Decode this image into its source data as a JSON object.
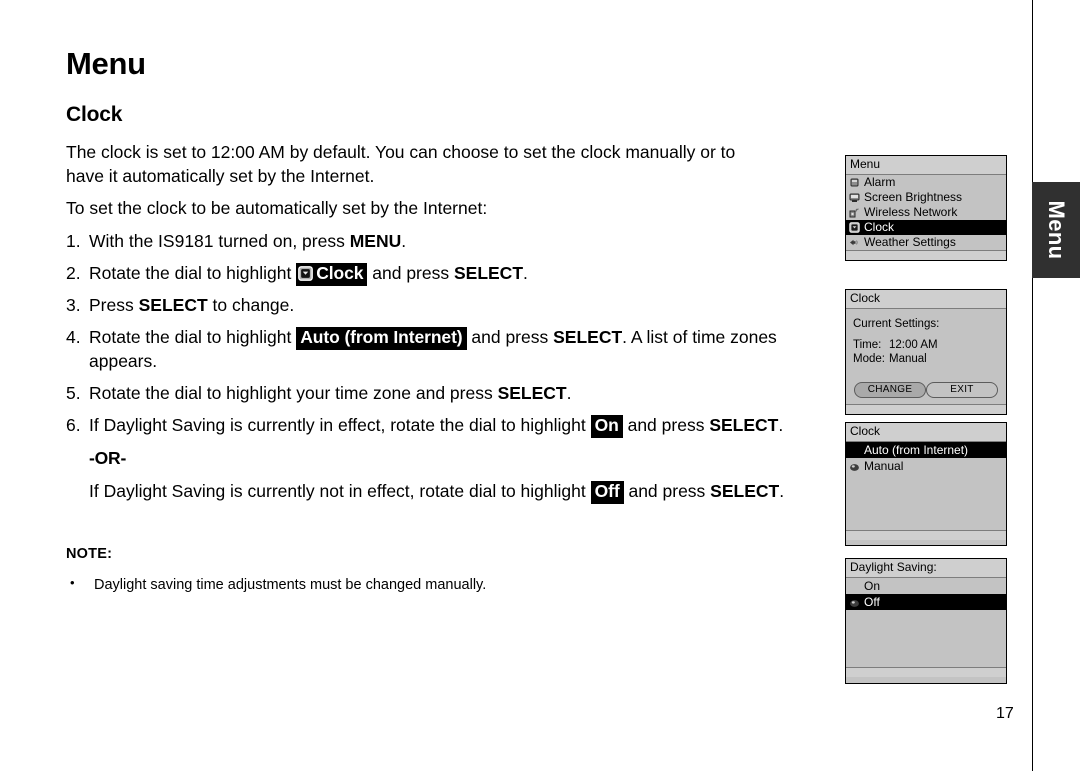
{
  "page": {
    "title": "Menu",
    "section_title": "Clock",
    "number": "17",
    "side_tab_label": "Menu"
  },
  "intro": {
    "paragraph_1_a": "The clock is set to 12:00 AM by default. You can choose to set the clock manually or to have it automatically set by the Internet.",
    "paragraph_2": "To set the clock to be automatically set by the Internet:"
  },
  "steps": [
    {
      "num": "1.",
      "parts": [
        {
          "t": "With the IS9181 turned on, press ",
          "s": "plain"
        },
        {
          "t": "MENU",
          "s": "bold"
        },
        {
          "t": ".",
          "s": "plain"
        }
      ]
    },
    {
      "num": "2.",
      "parts": [
        {
          "t": "Rotate the dial to highlight ",
          "s": "plain"
        },
        {
          "t": "Clock",
          "s": "badge-icon"
        },
        {
          "t": " and press ",
          "s": "plain"
        },
        {
          "t": "SELECT",
          "s": "bold"
        },
        {
          "t": ".",
          "s": "plain"
        }
      ]
    },
    {
      "num": "3.",
      "parts": [
        {
          "t": "Press ",
          "s": "plain"
        },
        {
          "t": "SELECT",
          "s": "bold"
        },
        {
          "t": " to change.",
          "s": "plain"
        }
      ]
    },
    {
      "num": "4.",
      "parts": [
        {
          "t": "Rotate the dial to highlight ",
          "s": "plain"
        },
        {
          "t": "Auto (from Internet)",
          "s": "badge"
        },
        {
          "t": " and press ",
          "s": "plain"
        },
        {
          "t": "SELECT",
          "s": "bold"
        },
        {
          "t": ". A list of time zones appears.",
          "s": "plain"
        }
      ]
    },
    {
      "num": "5.",
      "parts": [
        {
          "t": "Rotate the dial to highlight your time zone and press ",
          "s": "plain"
        },
        {
          "t": "SELECT",
          "s": "bold"
        },
        {
          "t": ".",
          "s": "plain"
        }
      ]
    },
    {
      "num": "6.",
      "parts": [
        {
          "t": "If Daylight Saving is currently in effect, rotate the dial to highlight ",
          "s": "plain"
        },
        {
          "t": "On",
          "s": "badge"
        },
        {
          "t": " and press ",
          "s": "plain"
        },
        {
          "t": "SELECT",
          "s": "bold"
        },
        {
          "t": ".",
          "s": "plain"
        }
      ]
    }
  ],
  "or_label": "-OR-",
  "alternate": {
    "parts": [
      {
        "t": "If Daylight Saving is currently not in effect, rotate dial to highlight ",
        "s": "plain"
      },
      {
        "t": "Off",
        "s": "badge"
      },
      {
        "t": " and press ",
        "s": "plain"
      },
      {
        "t": "SELECT",
        "s": "bold"
      },
      {
        "t": ".",
        "s": "plain"
      }
    ]
  },
  "note": {
    "title": "NOTE:",
    "bullet_glyph": "•",
    "items": [
      "Daylight saving time adjustments must be changed manually."
    ]
  },
  "screens": [
    {
      "id": "menu-screen",
      "title": "Menu",
      "rows": [
        {
          "icon": "alarm-icon",
          "label": "Alarm",
          "selected": false
        },
        {
          "icon": "screen-brightness-icon",
          "label": "Screen Brightness",
          "selected": false
        },
        {
          "icon": "wireless-network-icon",
          "label": "Wireless Network",
          "selected": false
        },
        {
          "icon": "clock-icon",
          "label": "Clock",
          "selected": true
        },
        {
          "icon": "weather-settings-icon",
          "label": "Weather Settings",
          "selected": false
        }
      ]
    },
    {
      "id": "clock-settings-screen",
      "title": "Clock",
      "heading": "Current Settings:",
      "fields": [
        {
          "key": "Time:",
          "value": "12:00 AM"
        },
        {
          "key": "Mode:",
          "value": "Manual"
        }
      ],
      "buttons": [
        {
          "label": "CHANGE",
          "active": true
        },
        {
          "label": "EXIT",
          "active": false
        }
      ]
    },
    {
      "id": "clock-mode-screen",
      "title": "Clock",
      "rows": [
        {
          "icon": "none",
          "label": "Auto (from Internet)",
          "selected": true
        },
        {
          "icon": "selected-dot-icon",
          "label": "Manual",
          "selected": false
        }
      ]
    },
    {
      "id": "daylight-saving-screen",
      "title": "Daylight Saving:",
      "rows": [
        {
          "icon": "none",
          "label": "On",
          "selected": false
        },
        {
          "icon": "selected-dot-icon",
          "label": "Off",
          "selected": true
        }
      ]
    }
  ],
  "colors": {
    "screen_bg": "#c3c3c3",
    "screen_titlebar": "#cfcfcf",
    "selection": "#000000",
    "side_tab": "#303030"
  }
}
